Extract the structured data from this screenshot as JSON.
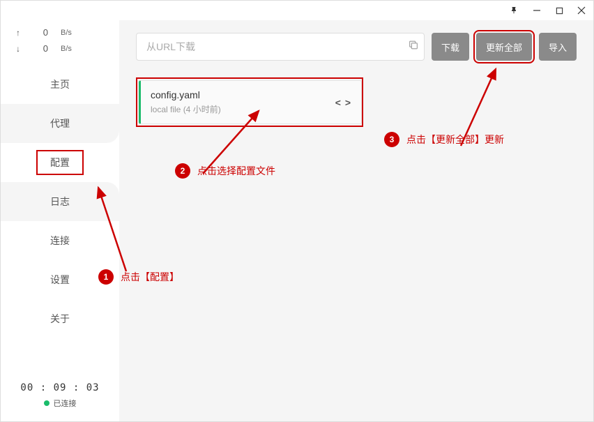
{
  "titlebar": {
    "pin_icon": "pin",
    "min_icon": "minimize",
    "max_icon": "maximize",
    "close_icon": "close"
  },
  "speeds": {
    "up_arrow": "↑",
    "up_value": "0",
    "up_unit": "B/s",
    "down_arrow": "↓",
    "down_value": "0",
    "down_unit": "B/s"
  },
  "nav": {
    "items": [
      {
        "label": "主页"
      },
      {
        "label": "代理"
      },
      {
        "label": "配置"
      },
      {
        "label": "日志"
      },
      {
        "label": "连接"
      },
      {
        "label": "设置"
      },
      {
        "label": "关于"
      }
    ]
  },
  "status": {
    "time": "00 : 09 : 03",
    "connected_label": "已连接"
  },
  "toolbar": {
    "url_placeholder": "从URL下载",
    "download_label": "下载",
    "update_all_label": "更新全部",
    "import_label": "导入"
  },
  "profile": {
    "name": "config.yaml",
    "subtitle": "local file (4 小时前)",
    "code_glyph": "< >"
  },
  "annotations": {
    "step1": {
      "num": "1",
      "text": "点击【配置】"
    },
    "step2": {
      "num": "2",
      "text": "点击选择配置文件"
    },
    "step3": {
      "num": "3",
      "text": "点击【更新全部】更新"
    }
  }
}
